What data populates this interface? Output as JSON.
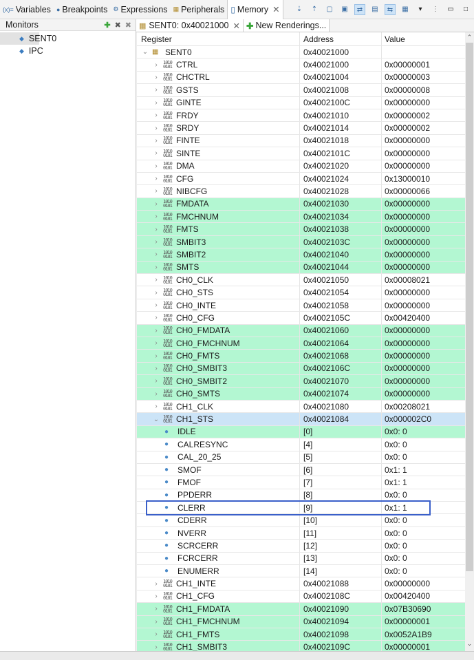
{
  "view_tabs": [
    {
      "label": "Variables",
      "icon": "variables-icon",
      "glyph": "(x)="
    },
    {
      "label": "Breakpoints",
      "icon": "breakpoints-icon",
      "glyph": "●"
    },
    {
      "label": "Expressions",
      "icon": "expressions-icon",
      "glyph": "⚙"
    },
    {
      "label": "Peripherals",
      "icon": "peripherals-icon",
      "glyph": "▦"
    },
    {
      "label": "Memory",
      "icon": "memory-icon",
      "glyph": "▯",
      "active": true
    }
  ],
  "monitors": {
    "title": "Monitors",
    "items": [
      "SENT0",
      "IPC"
    ],
    "selected": "SENT0"
  },
  "rendering_tabs": {
    "active": "SENT0: 0x40021000",
    "new": "New Renderings..."
  },
  "columns": [
    "Register",
    "Address",
    "Value"
  ],
  "colors": {
    "changed": "#b3f7d2",
    "selected": "#cce4f7",
    "highlight_box": "#3a5fc9"
  },
  "rows": [
    {
      "name": "SENT0",
      "addr": "0x40021000",
      "value": "",
      "type": "group",
      "expanded": true,
      "level": 0
    },
    {
      "name": "CTRL",
      "addr": "0x40021000",
      "value": "0x00000001",
      "type": "reg"
    },
    {
      "name": "CHCTRL",
      "addr": "0x40021004",
      "value": "0x00000003",
      "type": "reg"
    },
    {
      "name": "GSTS",
      "addr": "0x40021008",
      "value": "0x00000008",
      "type": "reg"
    },
    {
      "name": "GINTE",
      "addr": "0x4002100C",
      "value": "0x00000000",
      "type": "reg"
    },
    {
      "name": "FRDY",
      "addr": "0x40021010",
      "value": "0x00000002",
      "type": "reg"
    },
    {
      "name": "SRDY",
      "addr": "0x40021014",
      "value": "0x00000002",
      "type": "reg"
    },
    {
      "name": "FINTE",
      "addr": "0x40021018",
      "value": "0x00000000",
      "type": "reg"
    },
    {
      "name": "SINTE",
      "addr": "0x4002101C",
      "value": "0x00000000",
      "type": "reg"
    },
    {
      "name": "DMA",
      "addr": "0x40021020",
      "value": "0x00000000",
      "type": "reg"
    },
    {
      "name": "CFG",
      "addr": "0x40021024",
      "value": "0x13000010",
      "type": "reg"
    },
    {
      "name": "NIBCFG",
      "addr": "0x40021028",
      "value": "0x00000066",
      "type": "reg"
    },
    {
      "name": "FMDATA",
      "addr": "0x40021030",
      "value": "0x00000000",
      "type": "reg",
      "changed": true
    },
    {
      "name": "FMCHNUM",
      "addr": "0x40021034",
      "value": "0x00000000",
      "type": "reg",
      "changed": true
    },
    {
      "name": "FMTS",
      "addr": "0x40021038",
      "value": "0x00000000",
      "type": "reg",
      "changed": true
    },
    {
      "name": "SMBIT3",
      "addr": "0x4002103C",
      "value": "0x00000000",
      "type": "reg",
      "changed": true
    },
    {
      "name": "SMBIT2",
      "addr": "0x40021040",
      "value": "0x00000000",
      "type": "reg",
      "changed": true
    },
    {
      "name": "SMTS",
      "addr": "0x40021044",
      "value": "0x00000000",
      "type": "reg",
      "changed": true
    },
    {
      "name": "CH0_CLK",
      "addr": "0x40021050",
      "value": "0x00008021",
      "type": "reg"
    },
    {
      "name": "CH0_STS",
      "addr": "0x40021054",
      "value": "0x00000000",
      "type": "reg"
    },
    {
      "name": "CH0_INTE",
      "addr": "0x40021058",
      "value": "0x00000000",
      "type": "reg"
    },
    {
      "name": "CH0_CFG",
      "addr": "0x4002105C",
      "value": "0x00420400",
      "type": "reg"
    },
    {
      "name": "CH0_FMDATA",
      "addr": "0x40021060",
      "value": "0x00000000",
      "type": "reg",
      "changed": true
    },
    {
      "name": "CH0_FMCHNUM",
      "addr": "0x40021064",
      "value": "0x00000000",
      "type": "reg",
      "changed": true
    },
    {
      "name": "CH0_FMTS",
      "addr": "0x40021068",
      "value": "0x00000000",
      "type": "reg",
      "changed": true
    },
    {
      "name": "CH0_SMBIT3",
      "addr": "0x4002106C",
      "value": "0x00000000",
      "type": "reg",
      "changed": true
    },
    {
      "name": "CH0_SMBIT2",
      "addr": "0x40021070",
      "value": "0x00000000",
      "type": "reg",
      "changed": true
    },
    {
      "name": "CH0_SMTS",
      "addr": "0x40021074",
      "value": "0x00000000",
      "type": "reg",
      "changed": true
    },
    {
      "name": "CH1_CLK",
      "addr": "0x40021080",
      "value": "0x00208021",
      "type": "reg"
    },
    {
      "name": "CH1_STS",
      "addr": "0x40021084",
      "value": "0x000002C0",
      "type": "reg",
      "expanded": true,
      "selected": true
    },
    {
      "name": "IDLE",
      "addr": "[0]",
      "value": "0x0: 0",
      "type": "field",
      "changed": true
    },
    {
      "name": "CALRESYNC",
      "addr": "[4]",
      "value": "0x0: 0",
      "type": "field"
    },
    {
      "name": "CAL_20_25",
      "addr": "[5]",
      "value": "0x0: 0",
      "type": "field"
    },
    {
      "name": "SMOF",
      "addr": "[6]",
      "value": "0x1: 1",
      "type": "field"
    },
    {
      "name": "FMOF",
      "addr": "[7]",
      "value": "0x1: 1",
      "type": "field"
    },
    {
      "name": "PPDERR",
      "addr": "[8]",
      "value": "0x0: 0",
      "type": "field"
    },
    {
      "name": "CLERR",
      "addr": "[9]",
      "value": "0x1: 1",
      "type": "field",
      "highlighted": true
    },
    {
      "name": "CDERR",
      "addr": "[10]",
      "value": "0x0: 0",
      "type": "field"
    },
    {
      "name": "NVERR",
      "addr": "[11]",
      "value": "0x0: 0",
      "type": "field"
    },
    {
      "name": "SCRCERR",
      "addr": "[12]",
      "value": "0x0: 0",
      "type": "field"
    },
    {
      "name": "FCRCERR",
      "addr": "[13]",
      "value": "0x0: 0",
      "type": "field"
    },
    {
      "name": "ENUMERR",
      "addr": "[14]",
      "value": "0x0: 0",
      "type": "field"
    },
    {
      "name": "CH1_INTE",
      "addr": "0x40021088",
      "value": "0x00000000",
      "type": "reg"
    },
    {
      "name": "CH1_CFG",
      "addr": "0x4002108C",
      "value": "0x00420400",
      "type": "reg"
    },
    {
      "name": "CH1_FMDATA",
      "addr": "0x40021090",
      "value": "0x07B30690",
      "type": "reg",
      "changed": true
    },
    {
      "name": "CH1_FMCHNUM",
      "addr": "0x40021094",
      "value": "0x00000001",
      "type": "reg",
      "changed": true
    },
    {
      "name": "CH1_FMTS",
      "addr": "0x40021098",
      "value": "0x0052A1B9",
      "type": "reg",
      "changed": true
    },
    {
      "name": "CH1_SMBIT3",
      "addr": "0x4002109C",
      "value": "0x00000001",
      "type": "reg",
      "changed": true
    }
  ]
}
